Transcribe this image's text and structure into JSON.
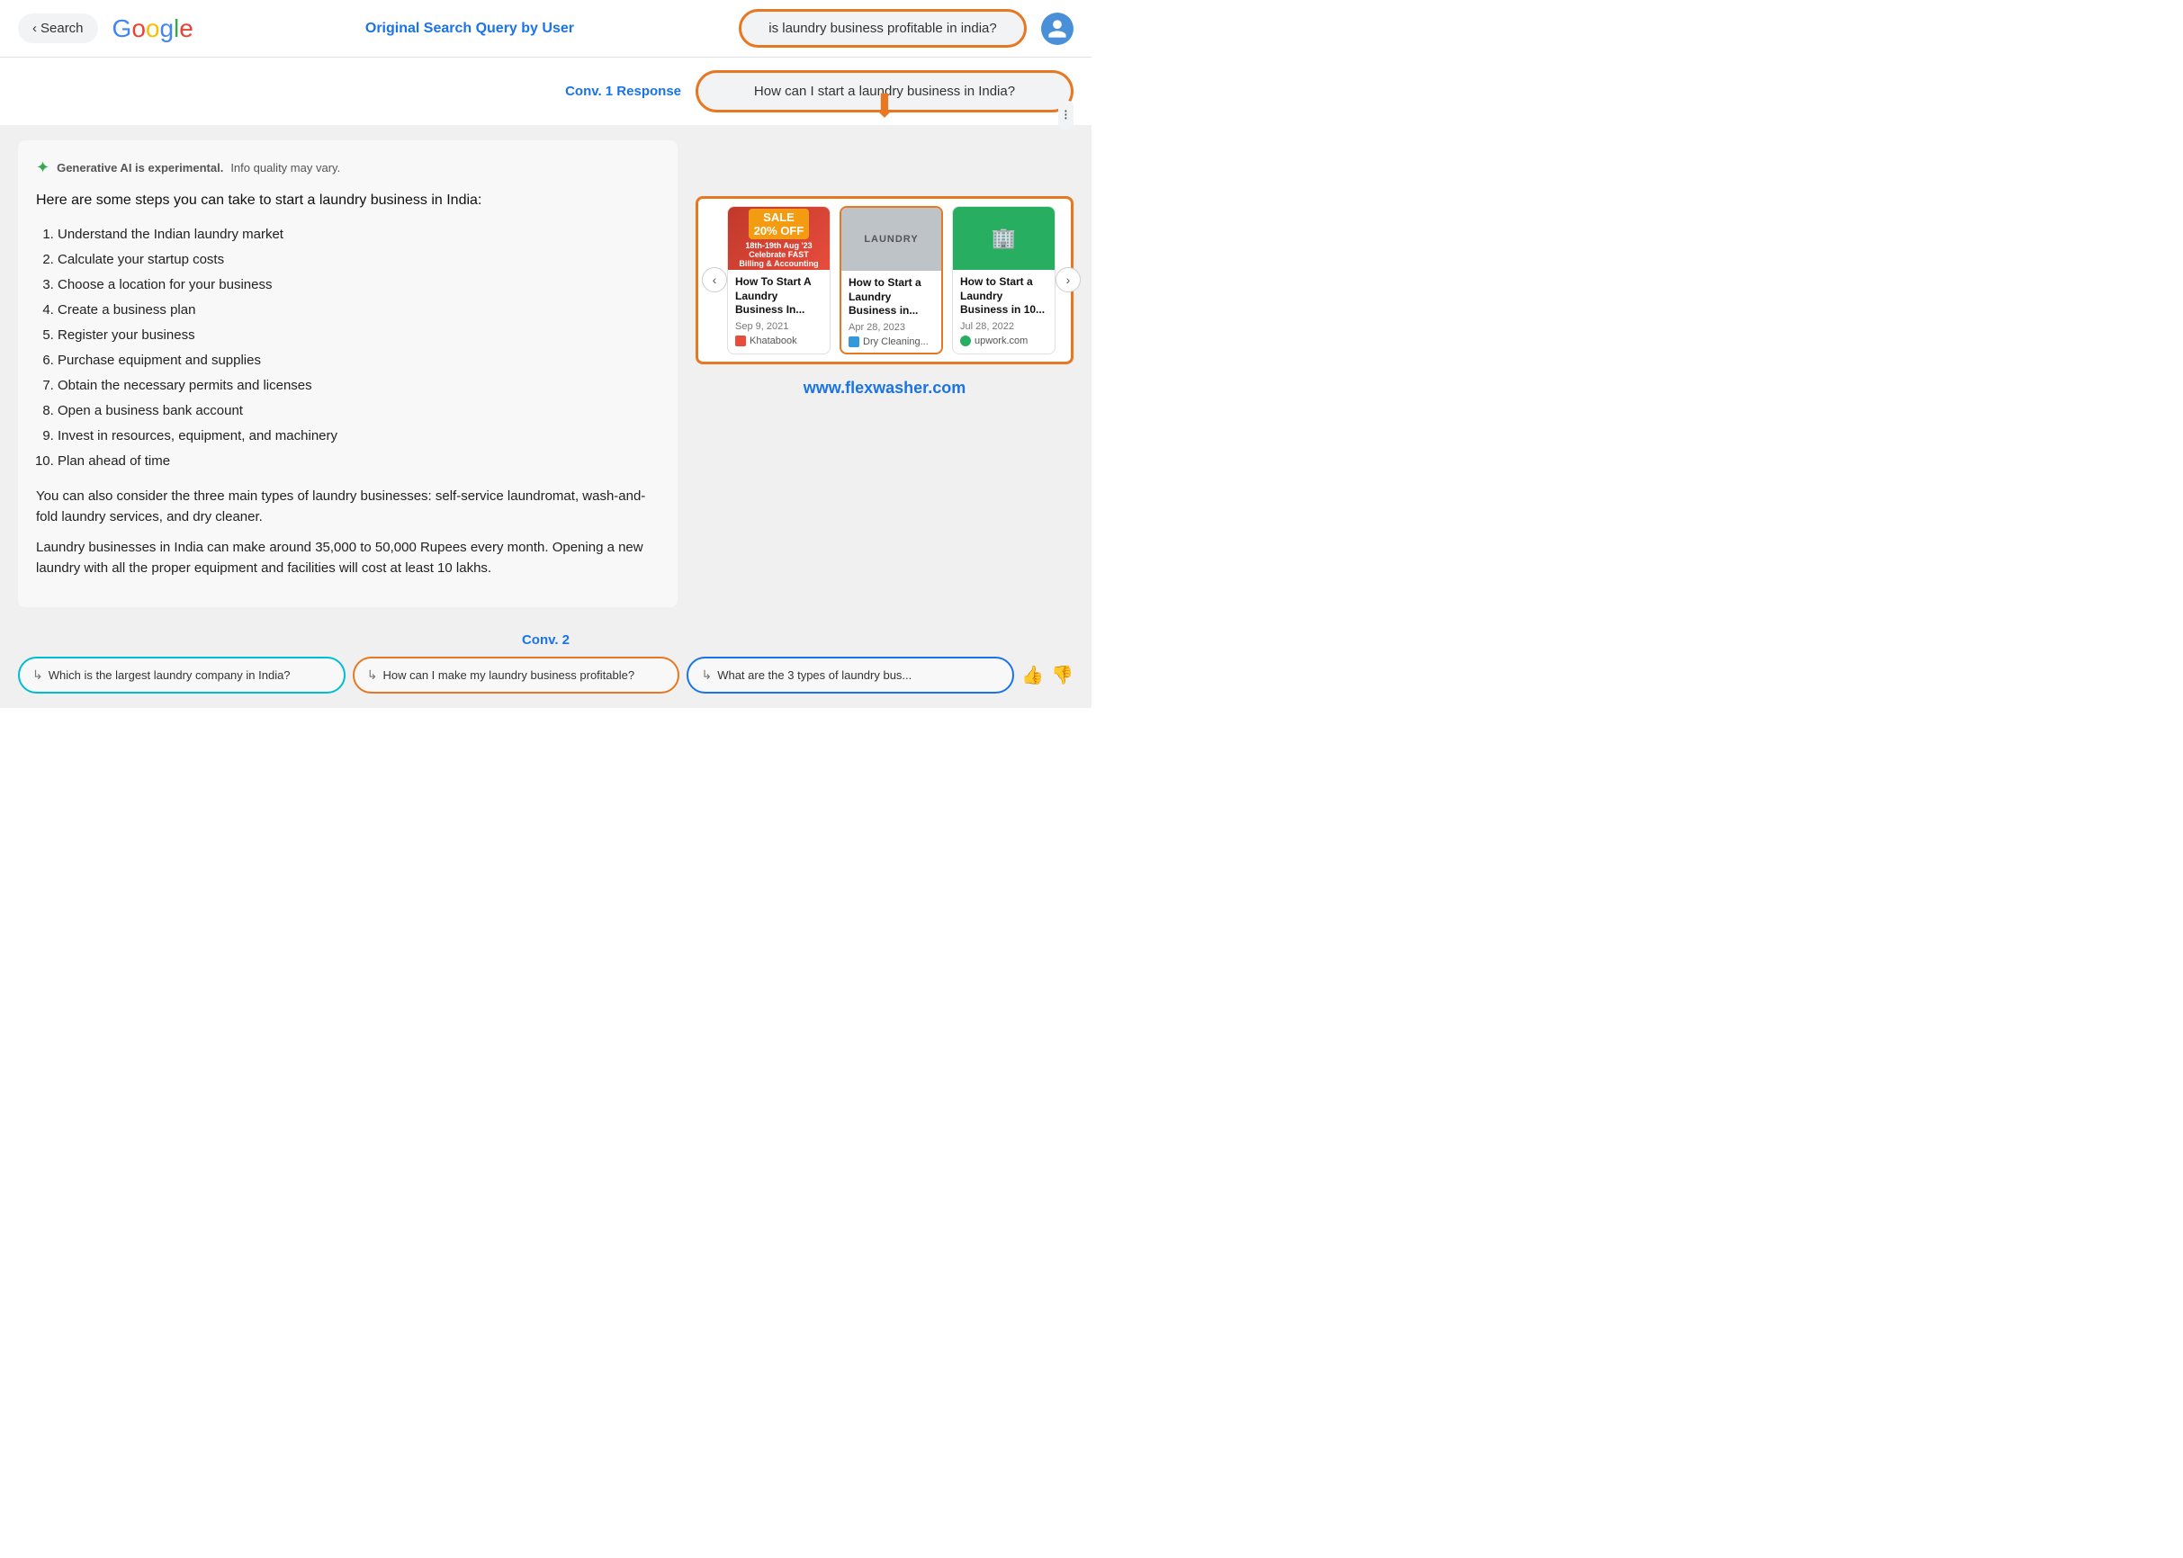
{
  "header": {
    "back_label": "Search",
    "google_letters": [
      "G",
      "o",
      "o",
      "g",
      "l",
      "e"
    ],
    "center_label": "Original Search Query by User",
    "search_query": "is laundry business profitable in india?"
  },
  "conv1": {
    "label": "Conv. 1 Response",
    "query": "How can I start a laundry business in India?"
  },
  "ai_notice": {
    "text_bold": "Generative AI is experimental.",
    "text_normal": "Info quality may vary."
  },
  "main_text": "Here are some steps you can take to start a laundry business in India:",
  "steps": [
    "Understand the Indian laundry market",
    "Calculate your startup costs",
    "Choose a location for your business",
    "Create a business plan",
    "Register your business",
    "Purchase equipment and supplies",
    "Obtain the necessary permits and licenses",
    "Open a business bank account",
    "Invest in resources, equipment, and machinery",
    "Plan ahead of time"
  ],
  "extra_text_1": "You can also consider the three main types of laundry businesses: self-service laundromat, wash-and-fold laundry services, and dry cleaner.",
  "extra_text_2": "Laundry businesses in India can make around 35,000 to 50,000 Rupees every month. Opening a new laundry with all the proper equipment and facilities will cost at least 10 lakhs.",
  "cards": [
    {
      "title": "How To Start A Laundry Business In...",
      "date": "Sep 9, 2021",
      "source": "Khatabook",
      "source_color": "#e74c3c",
      "thumb_type": "sale"
    },
    {
      "title": "How to Start a Laundry Business in...",
      "date": "Apr 28, 2023",
      "source": "Dry Cleaning...",
      "source_color": "#3498db",
      "thumb_type": "laundry",
      "highlighted": true
    },
    {
      "title": "How to Start a Laundry Business in 10...",
      "date": "Jul 28, 2022",
      "source": "upwork.com",
      "source_color": "#27ae60",
      "thumb_type": "green"
    }
  ],
  "flexwasher_url": "www.flexwasher.com",
  "conv2": {
    "label": "Conv. 2",
    "buttons": [
      {
        "text": "Which is the largest laundry company in India?",
        "border_class": "cyan-border"
      },
      {
        "text": "How can I make my laundry business profitable?",
        "border_class": "orange-border"
      },
      {
        "text": "What are the 3 types of laundry bus...",
        "border_class": "blue-border"
      }
    ]
  }
}
